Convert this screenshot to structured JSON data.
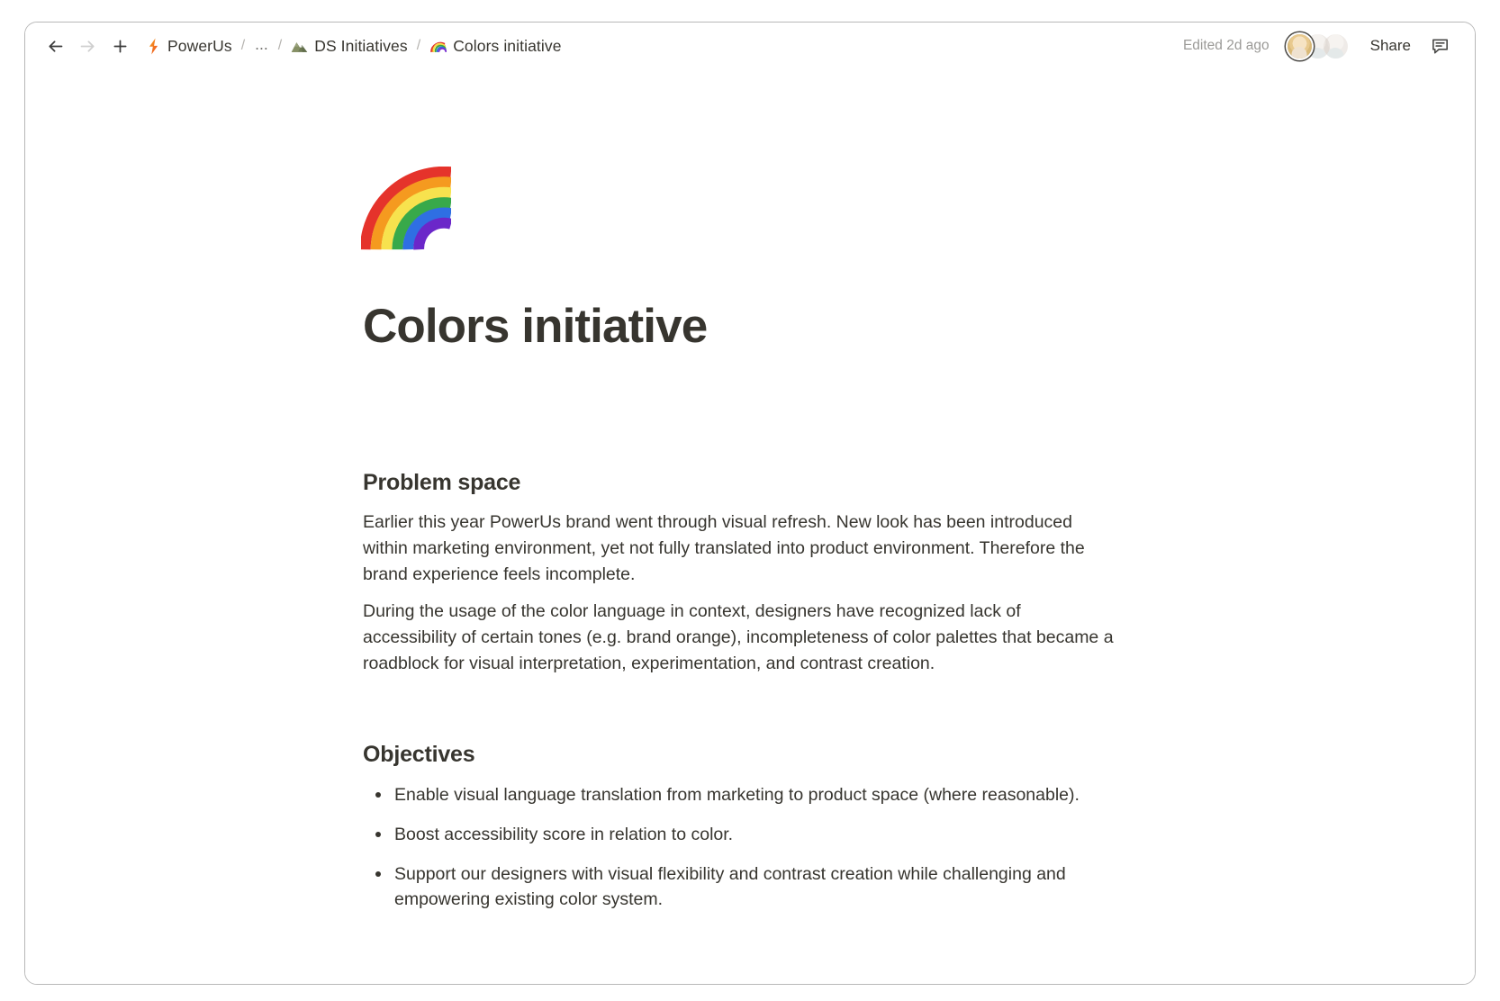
{
  "window": {
    "accent_color": "#37352f",
    "border_color": "#b8b8b8",
    "background": "#ffffff"
  },
  "topbar": {
    "nav": {
      "back_icon": "arrow-left-icon",
      "forward_icon": "arrow-right-icon",
      "new_icon": "plus-icon"
    },
    "breadcrumb": {
      "items": [
        {
          "icon": "lightning-bolt-icon",
          "label": "PowerUs"
        },
        {
          "icon": "none",
          "label": "..."
        },
        {
          "icon": "mountain-emoji",
          "label": "DS Initiatives"
        },
        {
          "icon": "rainbow-emoji",
          "label": "Colors initiative"
        }
      ],
      "separator": "/"
    },
    "edited_status": "Edited 2d ago",
    "avatars": [
      {
        "name": "collaborator-1",
        "state": "active"
      },
      {
        "name": "collaborator-2",
        "state": "faded"
      },
      {
        "name": "collaborator-3",
        "state": "faded"
      }
    ],
    "share_label": "Share",
    "comment_icon": "comment-bubble-icon"
  },
  "page": {
    "emoji": "rainbow-emoji",
    "title": "Colors initiative",
    "sections": [
      {
        "heading": "Problem space",
        "paragraphs": [
          "Earlier this year PowerUs brand went through visual refresh. New look has been introduced within marketing environment, yet not fully translated into product environment. Therefore the brand experience feels incomplete.",
          "During the usage of the color language in context, designers have recognized lack of accessibility of certain tones (e.g. brand orange), incompleteness of color palettes that became a roadblock for visual interpretation, experimentation, and contrast creation."
        ]
      },
      {
        "heading": "Objectives",
        "bullets": [
          "Enable visual language translation from marketing to product space (where reasonable).",
          "Boost accessibility score in relation to color.",
          "Support our designers with visual flexibility and contrast creation while challenging and empowering existing color system."
        ]
      }
    ]
  }
}
